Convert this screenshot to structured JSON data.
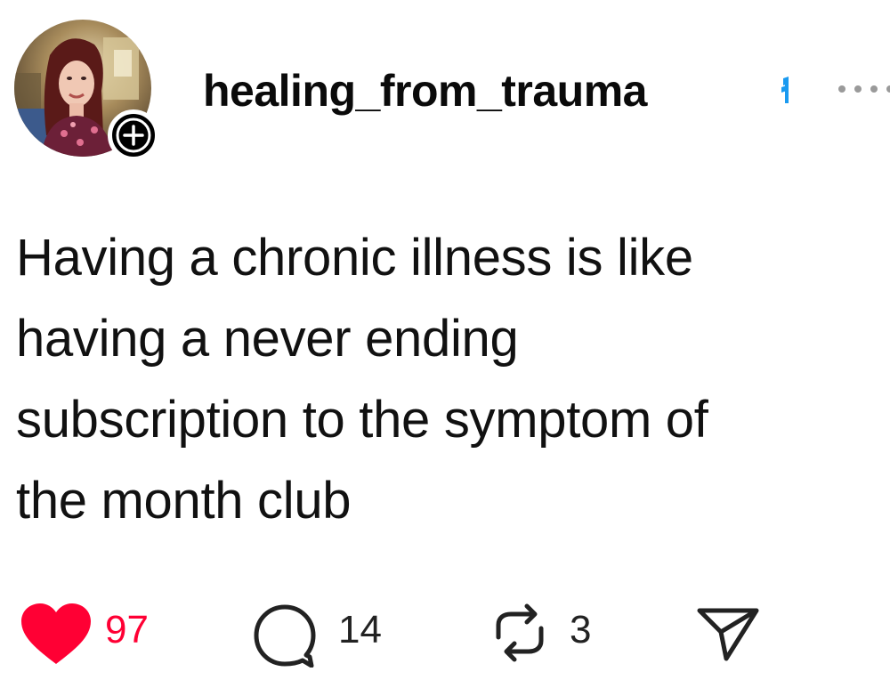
{
  "post": {
    "author": {
      "username": "healing_from_trauma",
      "avatar_icon": "profile-photo",
      "follow_icon": "plus-icon"
    },
    "text_lines": [
      "Having a chronic illness is like",
      "having a never ending",
      "subscription to the symptom of",
      "the month club"
    ],
    "actions": {
      "likes": "97",
      "replies": "14",
      "reposts": "3"
    }
  },
  "colors": {
    "like_accent": "#ff0034",
    "verified_accent": "#1a9af0",
    "text": "#111111",
    "icon": "#222222"
  }
}
